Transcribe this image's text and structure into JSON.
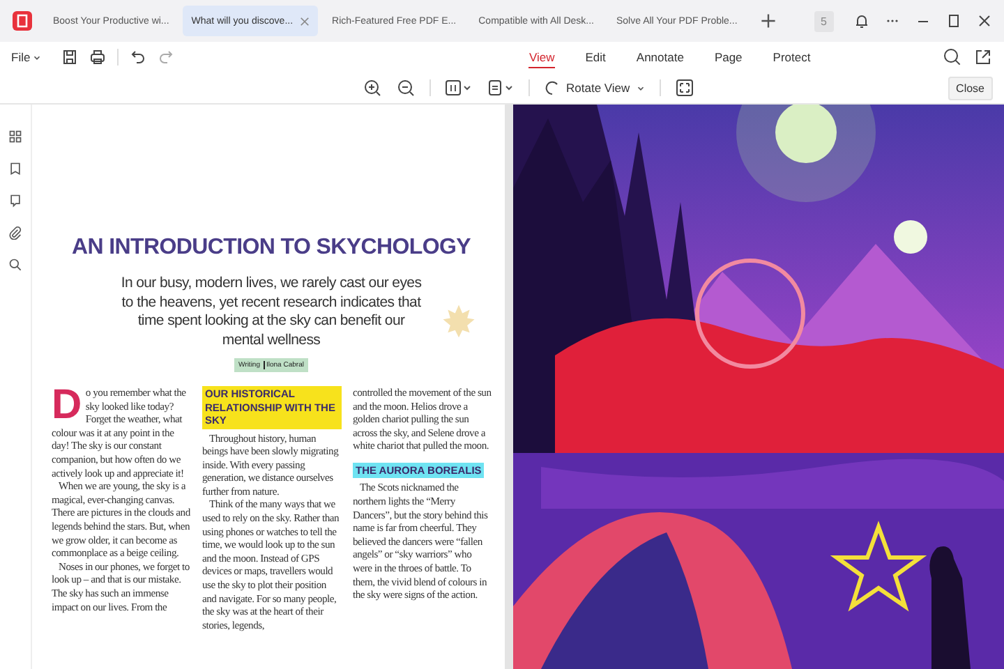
{
  "tabs": [
    {
      "label": "Boost Your Productive wi...",
      "selected": false
    },
    {
      "label": "What will you discove...",
      "selected": true
    },
    {
      "label": "Rich-Featured Free PDF E...",
      "selected": false
    },
    {
      "label": "Compatible with All Desk...",
      "selected": false
    },
    {
      "label": "Solve All Your PDF Proble...",
      "selected": false
    }
  ],
  "window_badge": "5",
  "toolbar": {
    "file_menu": "File",
    "ribbon_tabs": [
      {
        "label": "View",
        "selected": true
      },
      {
        "label": "Edit",
        "selected": false
      },
      {
        "label": "Annotate",
        "selected": false
      },
      {
        "label": "Page",
        "selected": false
      },
      {
        "label": "Protect",
        "selected": false
      }
    ],
    "rotate_view": "Rotate View",
    "close": "Close"
  },
  "document": {
    "title": "AN INTRODUCTION TO SKYCHOLOGY",
    "intro": "In our busy, modern lives, we rarely cast our eyes to the heavens, yet recent research indicates that time spent looking at the sky can benefit our mental wellness",
    "byline": {
      "category": "Writing",
      "author": "Ilona Cabral"
    },
    "columns": [
      [
        {
          "kind": "paragraph",
          "drop_cap": "D",
          "text": "o you remember what the sky looked like today? Forget the weather, what colour was it at any point in the day! The sky is our constant companion, but how often do we actively look up and appreciate it!"
        },
        {
          "kind": "paragraph",
          "text": "When we are young, the sky is a magical, ever-changing canvas. There are pictures in the clouds and legends behind the stars. But, when we grow older, it can become as commonplace as a beige ceiling."
        },
        {
          "kind": "paragraph",
          "text": "Noses in our phones, we forget to look up – and that is our mistake. The sky has such an immense impact on our lives. From the"
        }
      ],
      [
        {
          "kind": "heading",
          "text": "OUR HISTORICAL RELATIONSHIP WITH THE SKY",
          "color": "#f7e21c"
        },
        {
          "kind": "paragraph",
          "text": "Throughout history, human beings have been slowly migrating inside. With every passing generation, we distance ourselves further from nature."
        },
        {
          "kind": "paragraph",
          "text": "Think of the many ways that we used to rely on the sky. Rather than using phones or watches to tell the time, we would look up to the sun and the moon. Instead of GPS devices or maps, travellers would use the sky to plot their position and navigate. For so many people, the sky was at the heart of their stories, legends,"
        }
      ],
      [
        {
          "kind": "paragraph",
          "text": "controlled the movement of the sun and the moon. Helios drove a golden chariot pulling the sun across the sky, and Selene drove a white chariot that pulled the moon."
        },
        {
          "kind": "heading",
          "text": "THE AURORA BOREALIS",
          "color": "#6fe3f2"
        },
        {
          "kind": "paragraph",
          "text": "The Scots nicknamed the northern lights the “Merry Dancers”, but the story behind this name is far from cheerful. They believed the dancers were “fallen angels” or “sky warriors” who were in the throes of battle. To them, the vivid blend of colours in the sky were signs of the action."
        }
      ]
    ]
  }
}
